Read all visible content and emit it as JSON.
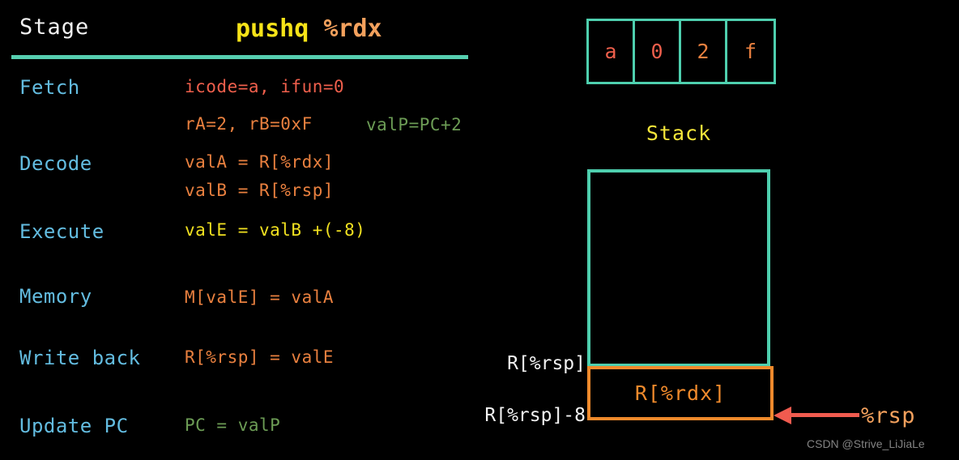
{
  "header": {
    "stage_column_label": "Stage",
    "instruction_op": "pushq",
    "instruction_reg": "%rdx"
  },
  "rows": [
    {
      "stage": "Fetch",
      "line1": "icode=a, ifun=0",
      "line1_color": "#ef5f4c",
      "line2": "rA=2, rB=0xF",
      "line2_color": "#e9803f",
      "line2_extra": "valP=PC+2",
      "line2_extra_color": "#6c9c55"
    },
    {
      "stage": "Decode",
      "line1": "valA = R[%rdx]",
      "line1_color": "#e9803f",
      "line2": "valB = R[%rsp]",
      "line2_color": "#e9803f"
    },
    {
      "stage": "Execute",
      "line1": "valE = valB +(-8)",
      "line1_color": "#f0e020"
    },
    {
      "stage": "Memory",
      "line1": "M[valE] = valA",
      "line1_color": "#e9803f"
    },
    {
      "stage": "Write back",
      "line1": "R[%rsp] = valE",
      "line1_color": "#e9803f"
    },
    {
      "stage": "Update PC",
      "line1": "PC = valP",
      "line1_color": "#6c9c55"
    }
  ],
  "encoding": {
    "bytes": [
      {
        "text": "a",
        "color": "#ef5f4c"
      },
      {
        "text": "0",
        "color": "#ef5f4c"
      },
      {
        "text": "2",
        "color": "#e9803f"
      },
      {
        "text": "f",
        "color": "#e9803f"
      }
    ]
  },
  "stack": {
    "title": "Stack",
    "top_label": "R[%rsp]",
    "bottom_label": "R[%rsp]-8",
    "pushed_value": "R[%rdx]",
    "pointer_label": "%rsp"
  },
  "colors": {
    "background": "#000000",
    "accent_teal": "#4ecfae",
    "accent_orange": "#f08a2c",
    "accent_yellow": "#f5e63a",
    "stage_blue": "#63bce0",
    "arrow_red": "#f05b4f"
  },
  "watermark": "CSDN @Strive_LiJiaLe"
}
